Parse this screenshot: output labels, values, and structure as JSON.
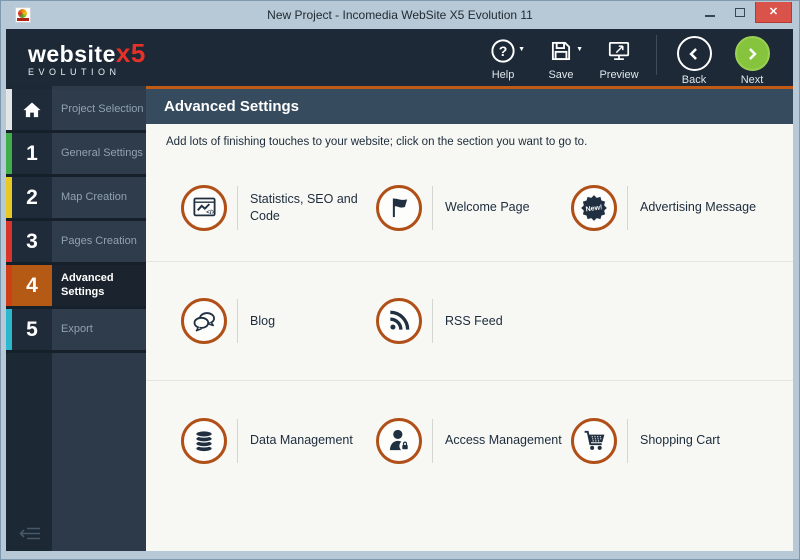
{
  "window": {
    "title": "New Project - Incomedia WebSite X5 Evolution 11"
  },
  "logo": {
    "brand": "website",
    "x5": "x5",
    "edition": "EVOLUTION"
  },
  "toolbar": {
    "help": "Help",
    "save": "Save",
    "preview": "Preview",
    "back": "Back",
    "next": "Next"
  },
  "sidebar": {
    "items": [
      {
        "label": "Project Selection",
        "icon": "home"
      },
      {
        "number": "1",
        "label": "General Settings"
      },
      {
        "number": "2",
        "label": "Map Creation"
      },
      {
        "number": "3",
        "label": "Pages Creation"
      },
      {
        "number": "4",
        "label": "Advanced Settings",
        "selected": true
      },
      {
        "number": "5",
        "label": "Export"
      }
    ]
  },
  "main": {
    "title": "Advanced Settings",
    "description": "Add lots of finishing touches to your website; click on the section you want to go to.",
    "features": [
      {
        "label": "Statistics, SEO and Code",
        "icon": "statistics-seo-code"
      },
      {
        "label": "Welcome Page",
        "icon": "welcome-page"
      },
      {
        "label": "Advertising Message",
        "icon": "advertising-message",
        "badge": "New!"
      },
      {
        "label": "Blog",
        "icon": "blog"
      },
      {
        "label": "RSS Feed",
        "icon": "rss-feed"
      },
      {
        "label": "Data Management",
        "icon": "data-management"
      },
      {
        "label": "Access Management",
        "icon": "access-management"
      },
      {
        "label": "Shopping Cart",
        "icon": "shopping-cart"
      }
    ]
  },
  "colors": {
    "titlebar_bg": "#b7c9d6",
    "toolbar_bg": "#1d2936",
    "accent_orange": "#c05a15",
    "icon_ring": "#b05018",
    "header_bg": "#364b5e",
    "content_bg": "#f7f7f4",
    "sidebar_icon_column": "#1f2b39",
    "sidebar_label_column": "#2e3c4b",
    "selected_step_bg": "#b55a14",
    "next_green": "#86c43e",
    "close_red": "#d9534b",
    "step_stripes": {
      "home": "#e3e5e6",
      "1": "#3fae49",
      "2": "#e8c822",
      "3": "#d8342c",
      "4": "#cf3f16",
      "5": "#2bb8cf"
    }
  }
}
